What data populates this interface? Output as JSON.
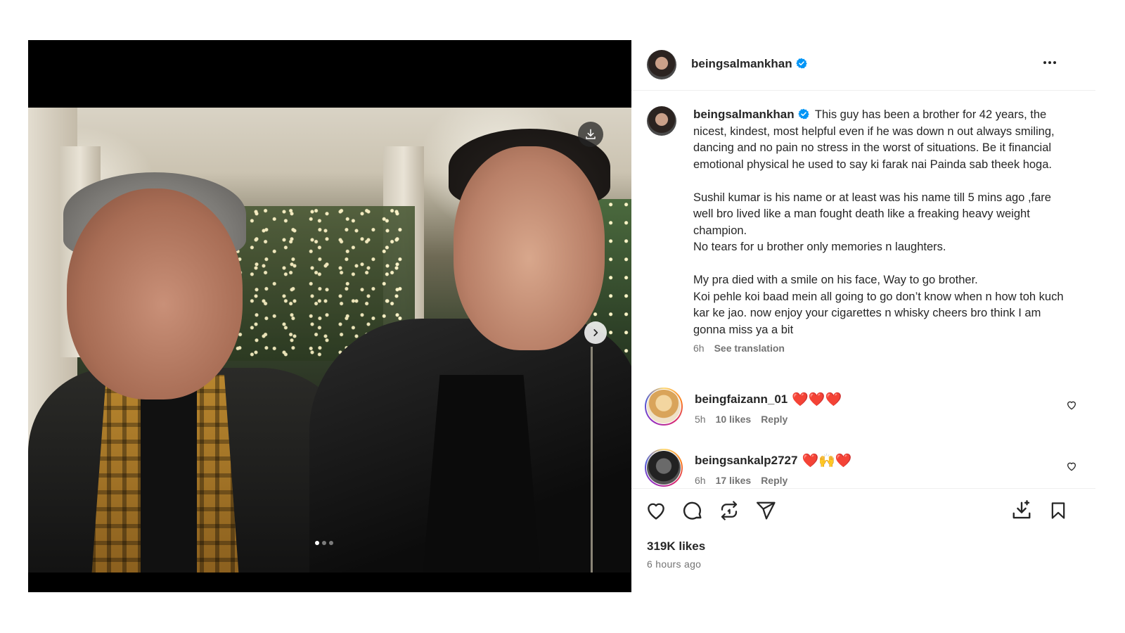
{
  "post": {
    "author": "beingsalmankhan",
    "caption": {
      "author": "beingsalmankhan",
      "paragraphs": [
        [
          "This guy has been a brother for 42 years, the nicest, kindest, most helpful even if he was down n out always smiling, dancing and no pain no stress in the worst of situations. Be it financial emotional physical he used to say ki farak nai Painda sab theek hoga."
        ],
        [
          "Sushil kumar is his name or at least was his name till 5 mins ago ,fare well bro lived like a man fought death like a freaking heavy weight champion.",
          "No tears for u brother only memories n laughters."
        ],
        [
          "My pra died with a smile on his face, Way to go brother.",
          "Koi pehle koi baad mein all going to go don’t know when n how toh kuch kar ke jao. now enjoy your cigarettes n whisky cheers bro think I am gonna miss ya a bit"
        ]
      ],
      "time": "6h",
      "see_translation": "See translation"
    },
    "comments": [
      {
        "username": "beingfaizann_01",
        "emojis": "❤️❤️❤️",
        "time": "5h",
        "likes": "10 likes",
        "reply": "Reply"
      },
      {
        "username": "beingsankalp2727",
        "emojis": "❤️🙌❤️",
        "time": "6h",
        "likes": "17 likes",
        "reply": "Reply"
      }
    ],
    "likes": "319K likes",
    "posted": "6 hours ago",
    "carousel": {
      "count": 3,
      "active": 0
    }
  },
  "icons": {
    "verified": "verified-badge-icon",
    "more": "more-options-icon",
    "download": "download-icon",
    "next": "chevron-right-icon",
    "like": "heart-icon",
    "comment": "comment-icon",
    "repost": "repost-icon",
    "share": "send-icon",
    "save_download": "save-to-device-icon",
    "bookmark": "bookmark-icon"
  },
  "colors": {
    "verified": "#0095f6",
    "text": "#262626",
    "muted": "#737373",
    "divider": "#efefef"
  }
}
